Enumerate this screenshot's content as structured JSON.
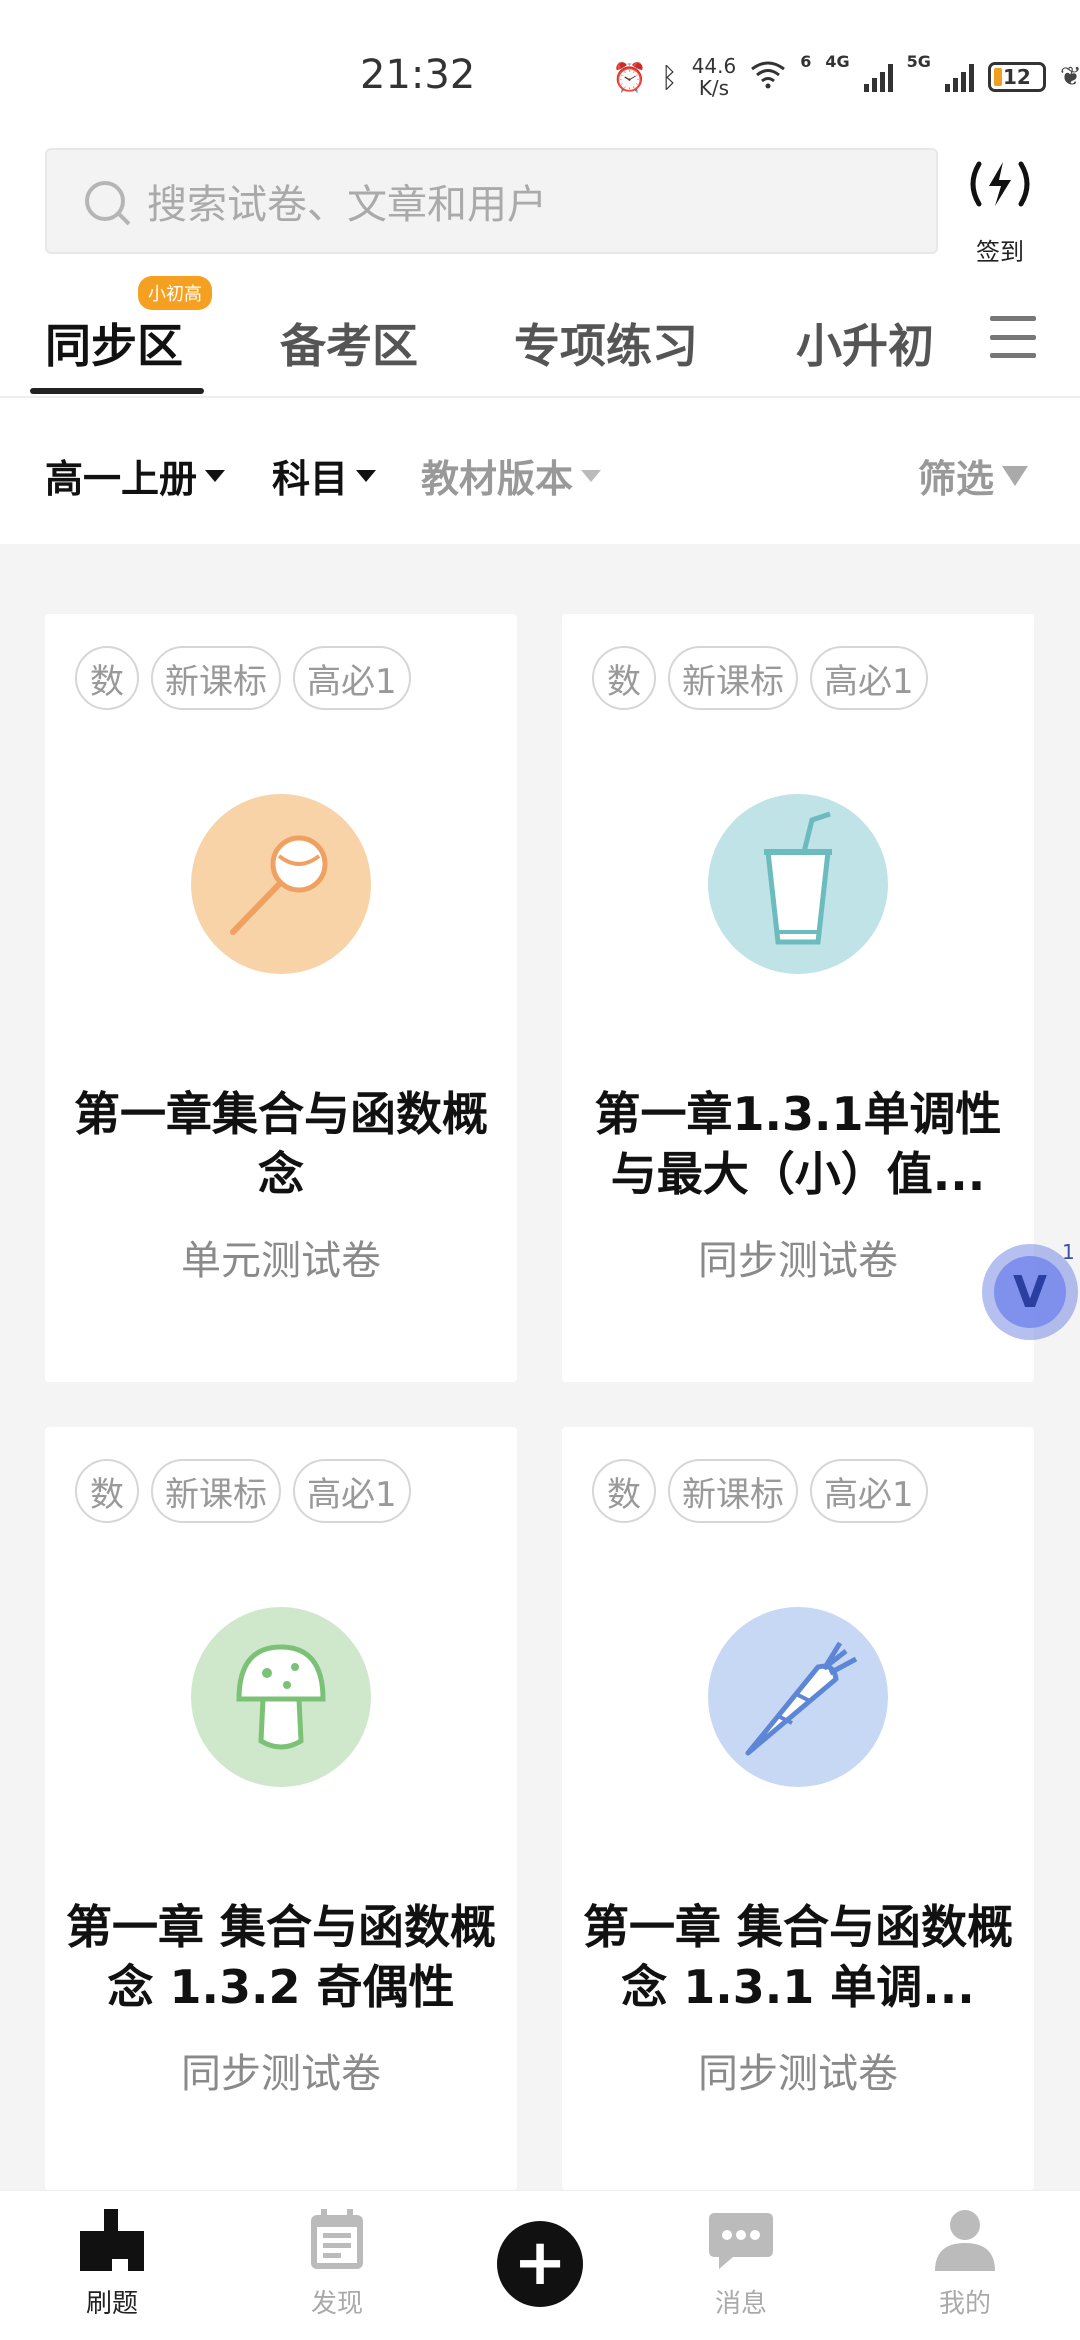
{
  "status_bar": {
    "time": "21:32",
    "net_speed_value": "44.6",
    "net_speed_unit": "K/s",
    "network_6": "6",
    "network_4g": "4G",
    "network_5g": "5G",
    "battery": "12"
  },
  "search": {
    "placeholder": "搜索试卷、文章和用户",
    "checkin_label": "签到"
  },
  "tabs": {
    "items": [
      "同步区",
      "备考区",
      "专项练习",
      "小升初"
    ],
    "active": "同步区",
    "badge": "小初高"
  },
  "filters": {
    "grade": "高一上册",
    "subject": "科目",
    "edition": "教材版本",
    "filter": "筛选"
  },
  "cards": [
    {
      "tags": [
        "数",
        "新课标",
        "高必1"
      ],
      "title": "第一章集合与函数概念",
      "subtitle": "单元测试卷",
      "icon": "lollipop-icon",
      "color": "#f8d3a8"
    },
    {
      "tags": [
        "数",
        "新课标",
        "高必1"
      ],
      "title": "第一章1.3.1单调性与最大（小）值...",
      "subtitle": "同步测试卷",
      "icon": "drink-cup-icon",
      "color": "#bfe3e6"
    },
    {
      "tags": [
        "数",
        "新课标",
        "高必1"
      ],
      "title": "第一章 集合与函数概念 1.3.2 奇偶性",
      "subtitle": "同步测试卷",
      "icon": "mushroom-icon",
      "color": "#cfe8cc"
    },
    {
      "tags": [
        "数",
        "新课标",
        "高必1"
      ],
      "title": "第一章 集合与函数概念 1.3.1 单调...",
      "subtitle": "同步测试卷",
      "icon": "carrot-icon",
      "color": "#c7d8f4"
    }
  ],
  "floating": {
    "badge": "1",
    "letter": "V"
  },
  "bottom_nav": {
    "items": [
      {
        "label": "刷题",
        "icon": "brush-icon"
      },
      {
        "label": "发现",
        "icon": "calendar-icon"
      },
      {
        "label": "消息",
        "icon": "chat-icon"
      },
      {
        "label": "我的",
        "icon": "person-icon"
      }
    ],
    "center_icon": "plus-icon"
  }
}
